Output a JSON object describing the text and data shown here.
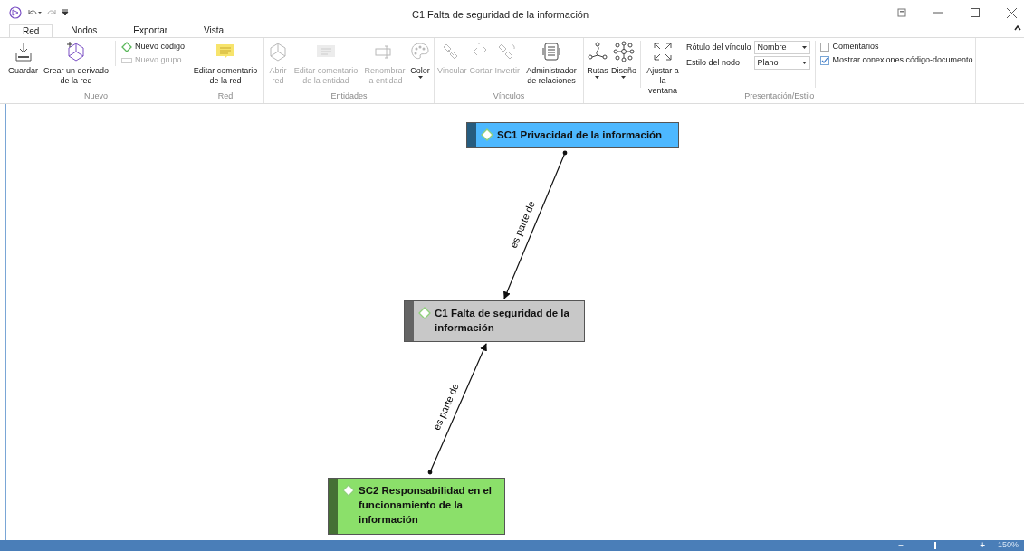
{
  "window": {
    "title": "C1 Falta de seguridad de la información"
  },
  "tabs": [
    {
      "label": "Red",
      "selected": true
    },
    {
      "label": "Nodos",
      "selected": false
    },
    {
      "label": "Exportar",
      "selected": false
    },
    {
      "label": "Vista",
      "selected": false
    }
  ],
  "ribbon": {
    "groups": [
      {
        "label": "Nuevo",
        "items": [
          {
            "kind": "large",
            "label": "Guardar",
            "disabled": false
          },
          {
            "kind": "large",
            "label": "Crear un derivado de la red",
            "disabled": false
          },
          {
            "kind": "smallstack",
            "items": [
              {
                "label": "Nuevo código",
                "disabled": false
              },
              {
                "label": "Nuevo grupo",
                "disabled": true
              }
            ]
          }
        ]
      },
      {
        "label": "Red",
        "items": [
          {
            "kind": "large",
            "label": "Editar comentario de la red",
            "disabled": false
          }
        ]
      },
      {
        "label": "Entidades",
        "items": [
          {
            "kind": "large",
            "label": "Abrir red",
            "disabled": true
          },
          {
            "kind": "large",
            "label": "Editar comentario de la entidad",
            "disabled": true
          },
          {
            "kind": "large",
            "label": "Renombrar la entidad",
            "disabled": true
          },
          {
            "kind": "large",
            "label": "Color",
            "disabled": false,
            "menu": true
          }
        ]
      },
      {
        "label": "Vínculos",
        "items": [
          {
            "kind": "large",
            "label": "Vincular",
            "disabled": true
          },
          {
            "kind": "large",
            "label": "Cortar",
            "disabled": true
          },
          {
            "kind": "large",
            "label": "Invertir",
            "disabled": true
          },
          {
            "kind": "large",
            "label": "Administrador de relaciones",
            "disabled": false
          }
        ]
      },
      {
        "label": "Presentación/Estilo",
        "items": [
          {
            "kind": "large",
            "label": "Rutas",
            "disabled": false,
            "menu": true
          },
          {
            "kind": "large",
            "label": "Diseño",
            "disabled": false,
            "menu": true
          },
          {
            "kind": "separator"
          },
          {
            "kind": "large",
            "label": "Ajustar a la ventana",
            "disabled": false
          },
          {
            "kind": "fields",
            "items": [
              {
                "label": "Rótulo del vínculo",
                "value": "Nombre"
              },
              {
                "label": "Estilo del nodo",
                "value": "Plano"
              }
            ]
          },
          {
            "kind": "checks",
            "items": [
              {
                "label": "Comentarios",
                "checked": false
              },
              {
                "label": "Mostrar conexiones código-documento",
                "checked": true
              }
            ]
          }
        ]
      }
    ]
  },
  "network": {
    "nodes": [
      {
        "label": "SC1 Privacidad de la información",
        "color": "#4db8ff"
      },
      {
        "label": "C1 Falta de seguridad de la información",
        "color": "#c8c8c8"
      },
      {
        "label": "SC2 Responsabilidad en el funcionamiento de la información",
        "color": "#8be06a"
      }
    ],
    "links": [
      {
        "label": "es parte de"
      },
      {
        "label": "es parte de"
      }
    ]
  },
  "status_bar": {
    "zoom": {
      "zoom_out": "−",
      "zoom_in": "+",
      "level": 0.4,
      "reading": "150%"
    }
  }
}
